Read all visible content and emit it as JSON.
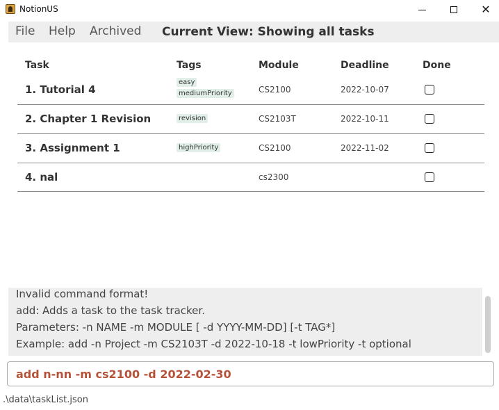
{
  "window": {
    "title": "NotionUS",
    "minimize_icon": "minimize-icon",
    "maximize_icon": "maximize-icon",
    "close_icon": "close-icon",
    "close_glyph": "✕"
  },
  "menu": {
    "file": "File",
    "help": "Help",
    "archived": "Archived",
    "current_view": "Current View: Showing all tasks"
  },
  "table": {
    "headers": {
      "task": "Task",
      "tags": "Tags",
      "module": "Module",
      "deadline": "Deadline",
      "done": "Done"
    },
    "rows": [
      {
        "name": "1. Tutorial 4",
        "tags": [
          "easy",
          "mediumPriority"
        ],
        "module": "CS2100",
        "deadline": "2022-10-07",
        "done": false
      },
      {
        "name": "2. Chapter 1 Revision",
        "tags": [
          "revision"
        ],
        "module": "CS2103T",
        "deadline": "2022-10-11",
        "done": false
      },
      {
        "name": "3. Assignment 1",
        "tags": [
          "highPriority"
        ],
        "module": "CS2100",
        "deadline": "2022-11-02",
        "done": false
      },
      {
        "name": "4. nal",
        "tags": [],
        "module": "cs2300",
        "deadline": "",
        "done": false
      }
    ]
  },
  "result": {
    "lines": [
      "Invalid command format!",
      "add: Adds a task to the task tracker.",
      "Parameters: -n NAME -m MODULE [ -d YYYY-MM-DD] [-t TAG*]",
      "Example: add -n Project -m CS2103T -d 2022-10-18 -t lowPriority -t optional"
    ]
  },
  "command": {
    "value": "add n-nn -m cs2100 -d 2022-02-30"
  },
  "status": {
    "file_path": ".\\data\\taskList.json"
  },
  "colors": {
    "command_text": "#b5533a",
    "tag_bg": "#e2efe9",
    "menu_bg": "#eeeeee"
  }
}
